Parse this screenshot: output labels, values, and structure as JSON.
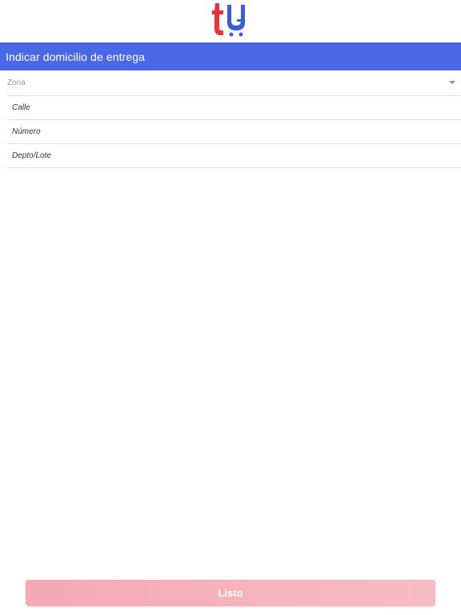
{
  "brand": {
    "logo_icon": "tu-cart-logo",
    "colors": {
      "red": "#e8323c",
      "blue": "#3b5bdb"
    }
  },
  "header": {
    "title": "Indicar domicilio de entrega",
    "background": "#4a68e6"
  },
  "form": {
    "zona": {
      "value": "Zona",
      "icon": "chevron-down-icon"
    },
    "calle": {
      "placeholder": "Calle"
    },
    "numero": {
      "placeholder": "Número"
    },
    "depto": {
      "placeholder": "Depto/Lote"
    }
  },
  "footer": {
    "done_label": "Listo"
  }
}
